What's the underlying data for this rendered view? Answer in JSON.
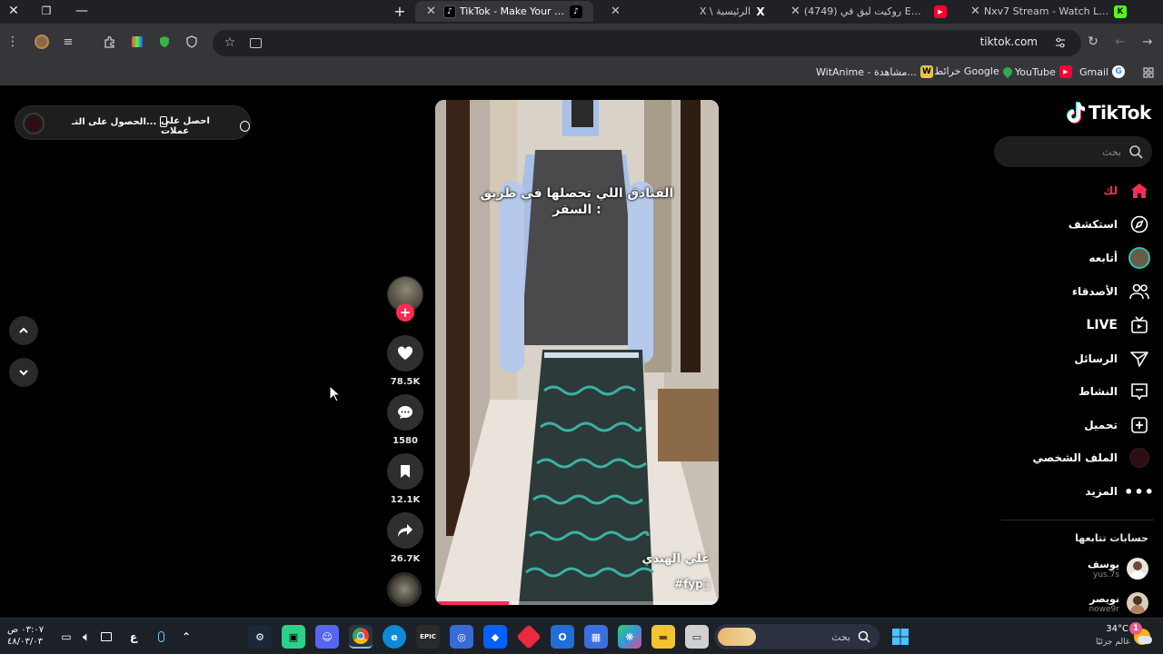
{
  "window": {
    "close": "✕",
    "restore": "❐",
    "minimize": "—",
    "new_tab": "+"
  },
  "tabs": [
    {
      "label": "TikTok - Make Your Day",
      "icon": "tiktok-icon",
      "active": true
    },
    {
      "label": "X \\ الرئيسية",
      "icon": "x-icon",
      "active": false
    },
    {
      "label": "(4749) روكيت ليق في EWC 26 -",
      "icon": "youtube-icon",
      "active": false
    },
    {
      "label": "Nxv7 Stream - Watch Live on Ki",
      "icon": "kick-icon",
      "active": false
    }
  ],
  "omnibox": {
    "url": "tiktok.com"
  },
  "bookmarks": [
    {
      "label": "Gmail",
      "icon": "google-icon"
    },
    {
      "label": "YouTube",
      "icon": "youtube-icon"
    },
    {
      "label": "خرائط Google",
      "icon": "maps-icon"
    },
    {
      "label": "WitAnime - مشاهدة...",
      "icon": "witanime-icon"
    }
  ],
  "tiktok": {
    "logo": "TikTok",
    "search_placeholder": "بحث",
    "nav": [
      {
        "label": "لك",
        "icon": "home-icon",
        "active": true
      },
      {
        "label": "استكشف",
        "icon": "compass-icon"
      },
      {
        "label": "أتابعه",
        "icon": "following-avatar-icon"
      },
      {
        "label": "الأصدقاء",
        "icon": "friends-icon"
      },
      {
        "label": "LIVE",
        "icon": "live-tv-icon"
      },
      {
        "label": "الرسائل",
        "icon": "send-icon"
      },
      {
        "label": "النشاط",
        "icon": "activity-icon"
      },
      {
        "label": "تحميل",
        "icon": "upload-icon"
      },
      {
        "label": "الملف الشخصي",
        "icon": "profile-avatar-icon"
      },
      {
        "label": "المزيد",
        "icon": "more-icon"
      }
    ],
    "following_title": "حسابات تتابعها",
    "following": [
      {
        "name": "يوسف",
        "handle": "yus.7s"
      },
      {
        "name": "نويصر",
        "handle": "nowe9r"
      }
    ],
    "coins": {
      "get_coins": "احصل على عملات",
      "get_app": "الحصول على التـ..."
    },
    "video": {
      "caption": "الفنادق اللي تحصلها في طريق السفر :",
      "author": "علي الهندي",
      "hashtag": "#fyp‌🏻",
      "progress": 0.26
    },
    "actions": {
      "likes": "78.5K",
      "comments": "1580",
      "saves": "12.1K",
      "shares": "26.7K"
    }
  },
  "taskbar": {
    "search_placeholder": "بحث",
    "weather_temp": "34°C",
    "weather_desc": "غالم جزئيًا",
    "time": "٠٣:٠٧ ص",
    "date": "٤٨/٠٣/٠٣",
    "lang": "ع"
  }
}
